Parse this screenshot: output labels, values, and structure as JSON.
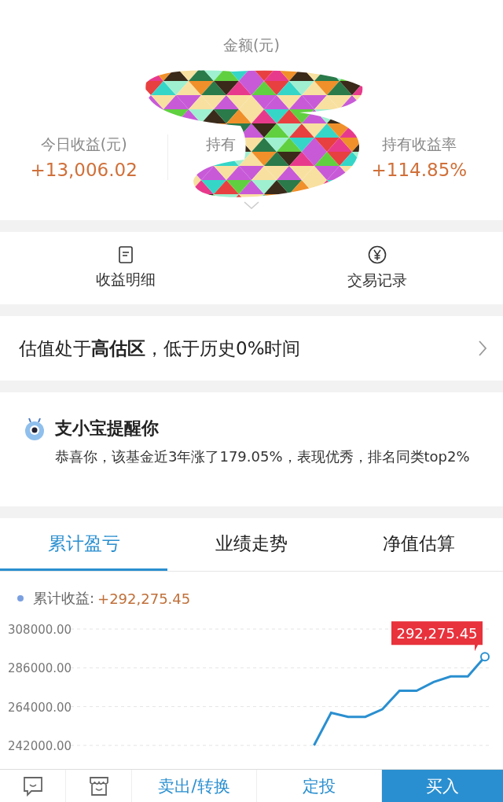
{
  "summary": {
    "title": "金额(元)",
    "stats": [
      {
        "label": "今日收益(元)",
        "value": "+13,006.02"
      },
      {
        "label": "持有"
      },
      {
        "label": "持有收益率",
        "value": "+114.85%"
      }
    ]
  },
  "actions": [
    {
      "kind": "detail",
      "label": "收益明细"
    },
    {
      "kind": "record",
      "label": "交易记录"
    }
  ],
  "valuation": {
    "parts": [
      "估值处于",
      "高估区",
      "，低于历史0%时间"
    ]
  },
  "reminder": {
    "title": "支小宝提醒你",
    "text": "恭喜你，该基金近3年涨了179.05%，表现优秀，排名同类top2%"
  },
  "tabs": [
    {
      "label": "累计盈亏",
      "selected": true
    },
    {
      "label": "业绩走势",
      "selected": false
    },
    {
      "label": "净值估算",
      "selected": false
    }
  ],
  "legend": {
    "label": "累计收益:",
    "value": "+292,275.45",
    "color": "#7a9fe0"
  },
  "chart": {
    "chart_data": {
      "type": "line",
      "yticks": [
        {
          "value": 242000,
          "label": "242000.00"
        },
        {
          "value": 264000,
          "label": "264000.00"
        },
        {
          "value": 286000,
          "label": "286000.00"
        },
        {
          "value": 308000,
          "label": "308000.00"
        }
      ],
      "grid": true,
      "ylim": [
        242000,
        308000
      ],
      "series": [
        {
          "color": "#2a8fd0",
          "values": [
            null,
            null,
            null,
            null,
            null,
            null,
            null,
            null,
            null,
            null,
            null,
            null,
            null,
            null,
            242000,
            260500,
            258200,
            258200,
            262500,
            273000,
            273000,
            278000,
            281100,
            281100,
            292300
          ]
        }
      ],
      "annotations": [
        {
          "text": "292,275.45"
        }
      ]
    }
  },
  "bottom_bar": [
    {
      "kind": "chat"
    },
    {
      "kind": "store"
    },
    {
      "kind": "text",
      "label": "卖出/转换"
    },
    {
      "kind": "text",
      "label": "定投"
    },
    {
      "kind": "primary",
      "label": "买入"
    }
  ]
}
